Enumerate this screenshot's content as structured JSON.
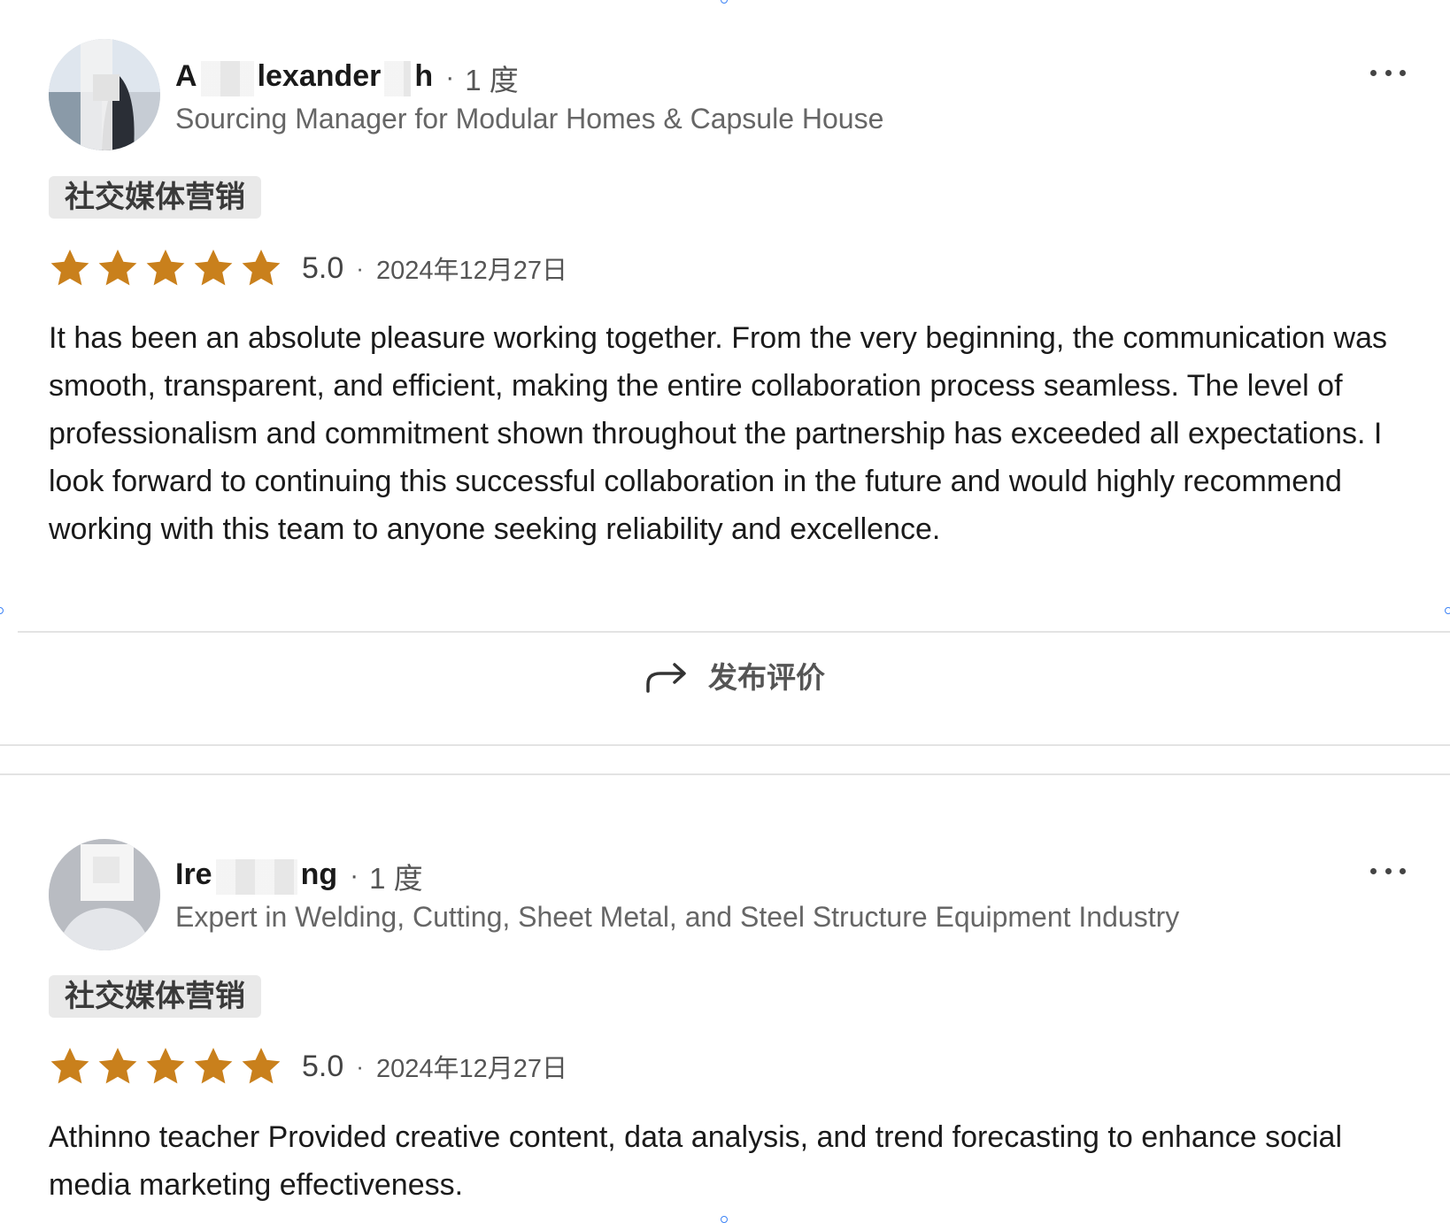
{
  "reviews": [
    {
      "name_start": "A",
      "name_mid": "lexander",
      "name_end": "h",
      "degree": "1 度",
      "headline": "Sourcing Manager for Modular Homes & Capsule House",
      "tag": "社交媒体营销",
      "rating": 5,
      "score": "5.0",
      "date": "2024年12月27日",
      "text": "It has been an absolute pleasure working together. From the very beginning, the communication was smooth, transparent, and efficient, making the entire collaboration process seamless. The level of professionalism and commitment shown throughout the partnership has exceeded all expectations. I look forward to continuing this successful collaboration in the future and would highly recommend working with this team to anyone seeking reliability and excellence."
    },
    {
      "name_start": "Ire",
      "name_mid": "",
      "name_end": "ng",
      "degree": "1 度",
      "headline": "Expert in Welding, Cutting, Sheet Metal, and Steel Structure Equipment Industry",
      "tag": "社交媒体营销",
      "rating": 5,
      "score": "5.0",
      "date": "2024年12月27日",
      "text": "Athinno teacher Provided creative content, data analysis, and trend forecasting to enhance social media marketing effectiveness."
    }
  ],
  "post_review": {
    "label": "发布评价",
    "icon": "share-arrow-icon"
  },
  "colors": {
    "star": "#c9801c",
    "tag_bg": "#e9e9e9",
    "divider": "#e3e3e3"
  }
}
